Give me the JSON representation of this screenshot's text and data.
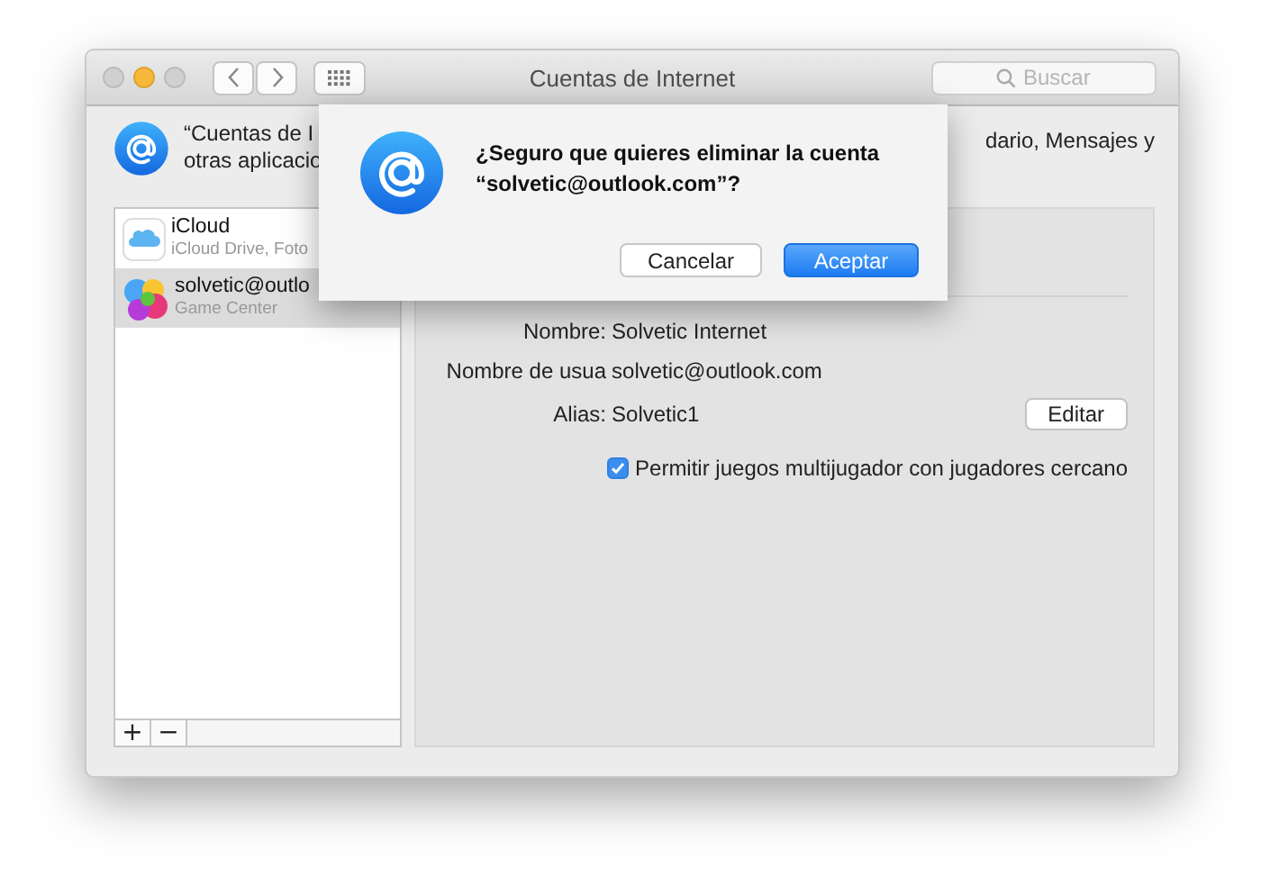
{
  "window": {
    "title": "Cuentas de Internet",
    "search": {
      "placeholder": "Buscar"
    }
  },
  "description": {
    "left_lines": [
      "“Cuentas de I",
      "otras aplicacio"
    ],
    "right_line": "dario, Mensajes y"
  },
  "accounts": [
    {
      "name": "iCloud",
      "detail": "iCloud Drive, Foto",
      "kind": "icloud",
      "selected": false
    },
    {
      "name": "solvetic@outlo",
      "detail": "Game Center",
      "kind": "gamecenter",
      "selected": true
    }
  ],
  "list_buttons": [
    "+",
    "−"
  ],
  "details": {
    "fields": [
      {
        "label": "Nombre:",
        "value": "Solvetic Internet"
      },
      {
        "label": "Nombre de usua",
        "value": "solvetic@outlook.com"
      },
      {
        "label": "Alias:",
        "value": "Solvetic1",
        "action": "Editar"
      }
    ],
    "checkbox": {
      "label": "Permitir juegos multijugador con jugadores cercano",
      "checked": true
    }
  },
  "dialog": {
    "message": "¿Seguro que quieres eliminar la cuenta\n“solvetic@outlook.com”?",
    "buttons": [
      {
        "label": "Cancelar",
        "default": false
      },
      {
        "label": "Aceptar",
        "default": true
      }
    ]
  }
}
